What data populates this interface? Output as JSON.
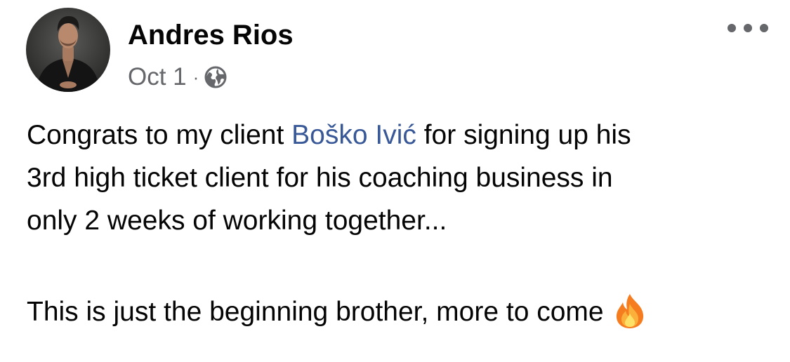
{
  "post": {
    "author": "Andres Rios",
    "date": "Oct 1",
    "separator": "·",
    "privacy_icon": "globe-icon",
    "more_icon": "more-horizontal-icon",
    "lines": [
      {
        "before": "Congrats to my client ",
        "mention": "Boško Ivić",
        "after": " for signing up his"
      },
      "3rd high ticket client for his coaching business in",
      "only 2 weeks of working together...",
      "This is just the beginning brother, more to come"
    ],
    "emoji": "fire-emoji"
  },
  "colors": {
    "text": "#050505",
    "meta": "#65676b",
    "mention": "#385898",
    "background": "#ffffff"
  }
}
